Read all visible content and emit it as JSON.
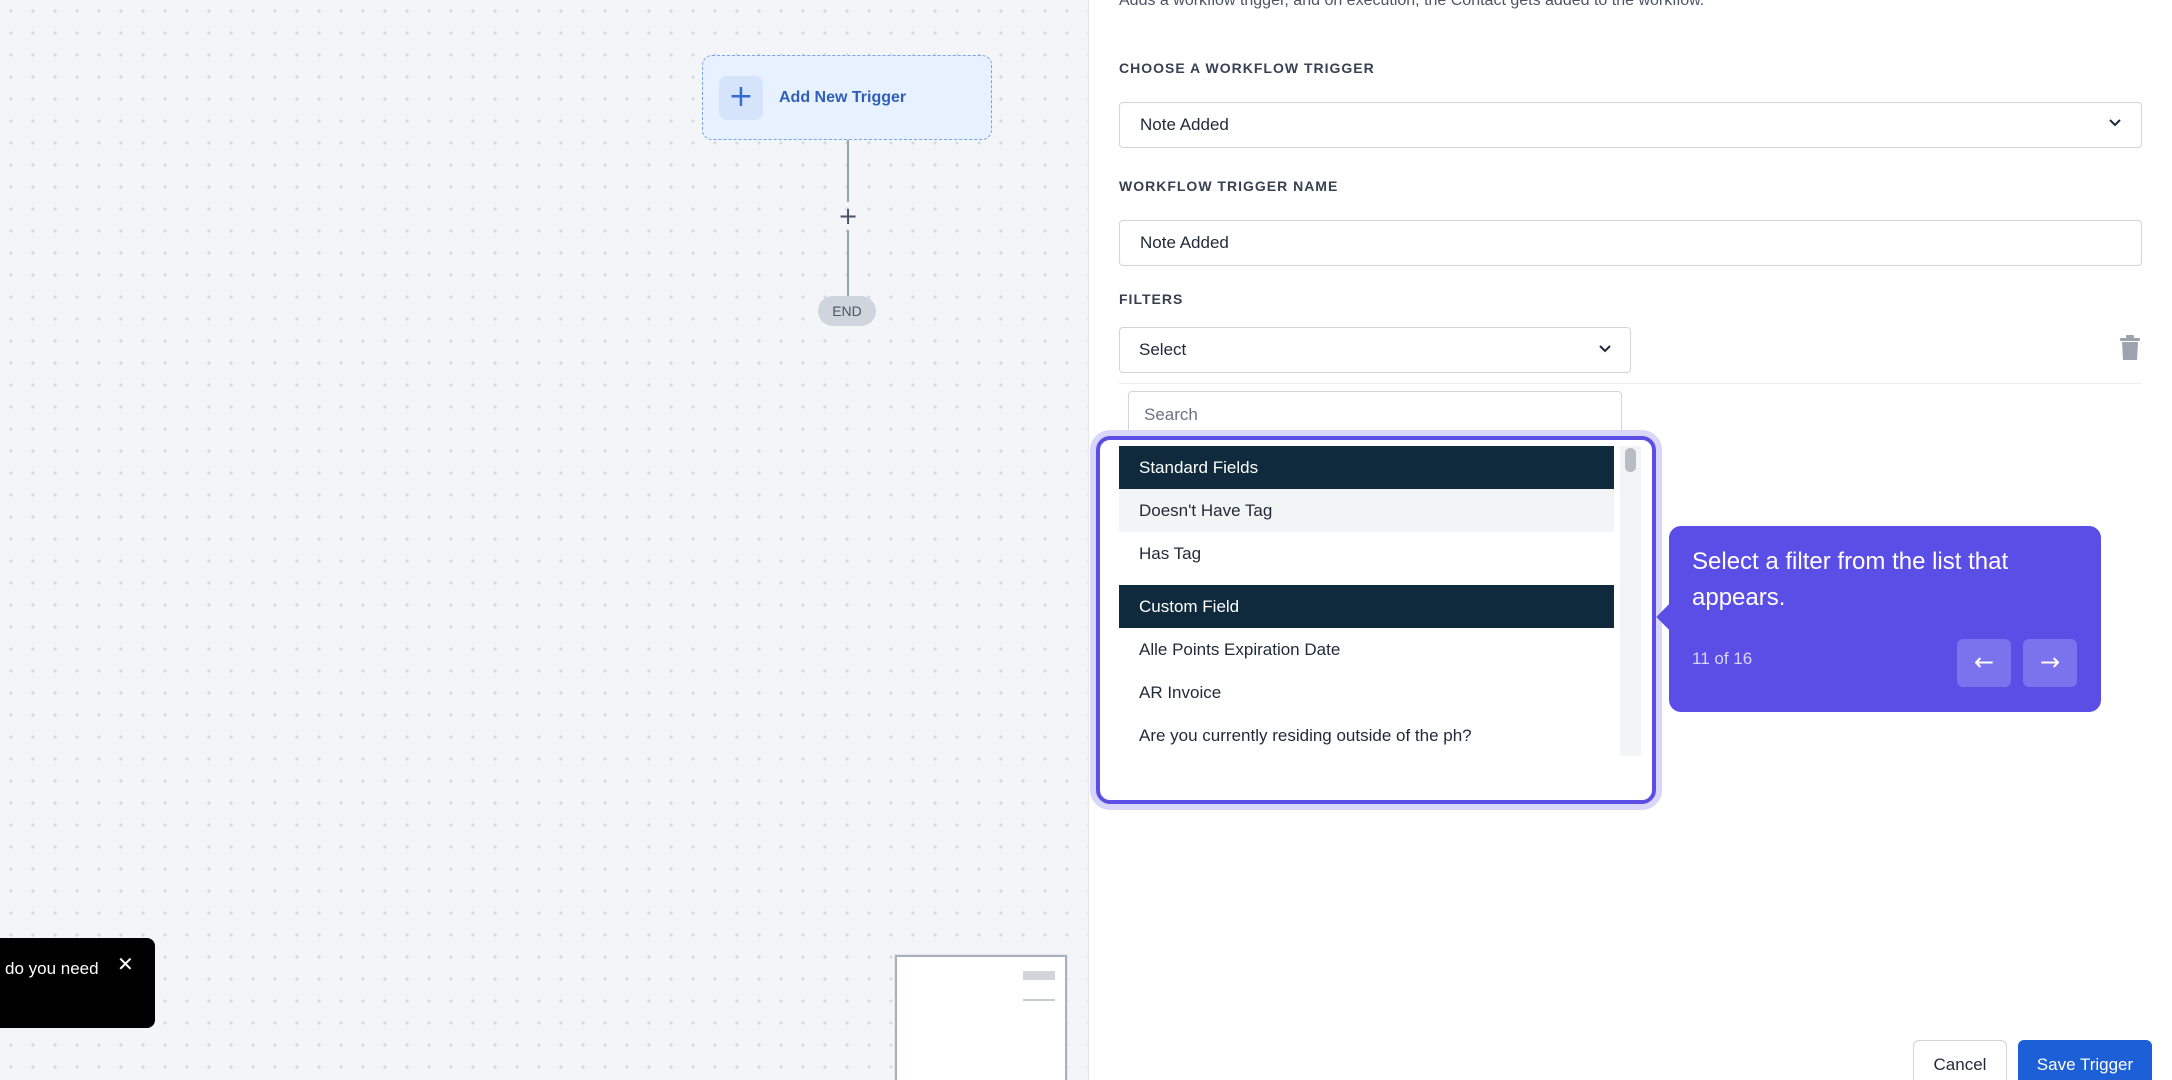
{
  "canvas": {
    "trigger_label": "Add New Trigger",
    "add_step_symbol": "+",
    "end_label": "END",
    "toast_text": "do you need",
    "toast_close": "✕"
  },
  "panel": {
    "description": "Adds a workflow trigger, and on execution, the Contact gets added to the workflow.",
    "choose_trigger_label": "CHOOSE A WORKFLOW TRIGGER",
    "choose_trigger_value": "Note Added",
    "trigger_name_label": "WORKFLOW TRIGGER NAME",
    "trigger_name_value": "Note Added",
    "filters_label": "FILTERS",
    "filter_select_value": "Select",
    "search_placeholder": "Search",
    "groups": [
      {
        "header": "Standard Fields",
        "items": [
          "Doesn't Have Tag",
          "Has Tag"
        ]
      },
      {
        "header": "Custom Field",
        "items": [
          "Alle Points Expiration Date",
          "AR Invoice",
          "Are you currently residing outside of the ph?"
        ]
      }
    ]
  },
  "tooltip": {
    "text": "Select a filter from the list that appears.",
    "step": "11 of 16",
    "prev_symbol": "←",
    "next_symbol": "→"
  },
  "footer": {
    "cancel_label": "Cancel",
    "save_label": "Save Trigger"
  },
  "colors": {
    "accent": "#5a4ee6",
    "primary_button": "#1d5fd6",
    "group_header": "#0f2a3c"
  }
}
